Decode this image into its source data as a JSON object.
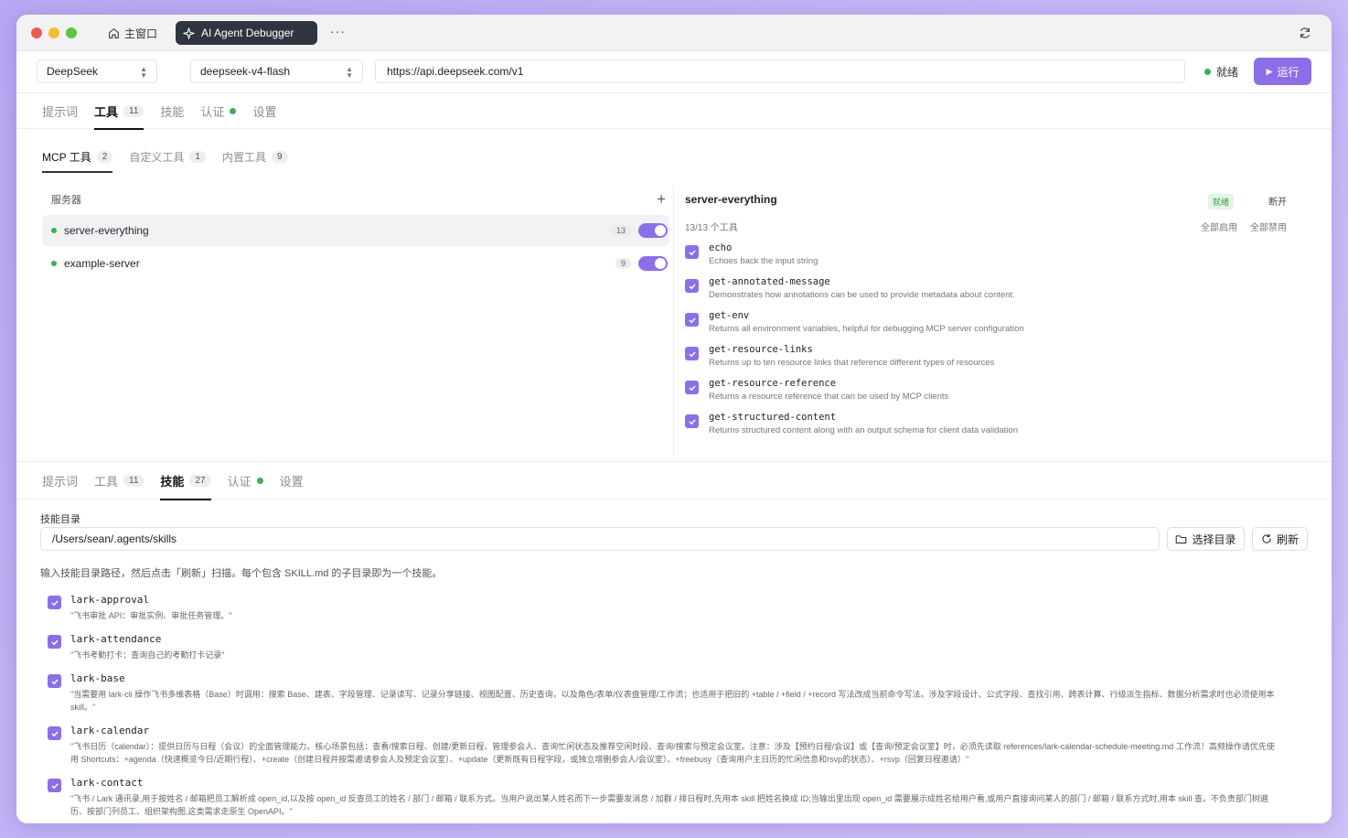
{
  "titlebar": {
    "home_tab": "主窗口",
    "active_tab": "AI Agent Debugger",
    "more": "···"
  },
  "toolbar": {
    "provider": "DeepSeek",
    "model": "deepseek-v4-flash",
    "url": "https://api.deepseek.com/v1",
    "status": "就绪",
    "run_label": "运行"
  },
  "upper": {
    "tabs": [
      {
        "label": "提示词"
      },
      {
        "label": "工具",
        "badge": "11"
      },
      {
        "label": "技能"
      },
      {
        "label": "认证"
      },
      {
        "label": "设置"
      }
    ],
    "subtabs": [
      {
        "label": "MCP 工具",
        "badge": "2"
      },
      {
        "label": "自定义工具",
        "badge": "1"
      },
      {
        "label": "内置工具",
        "badge": "9"
      }
    ],
    "servers_label": "服务器",
    "add": "+",
    "servers": [
      {
        "name": "server-everything",
        "count": "13"
      },
      {
        "name": "example-server",
        "count": "9"
      }
    ],
    "detail": {
      "title": "server-everything",
      "ready": "就绪",
      "disconnect": "断开",
      "summary": "13/13 个工具",
      "enable_all": "全部启用",
      "disable_all": "全部禁用",
      "tools": [
        {
          "name": "echo",
          "desc": "Echoes back the input string"
        },
        {
          "name": "get-annotated-message",
          "desc": "Demonstrates how annotations can be used to provide metadata about content."
        },
        {
          "name": "get-env",
          "desc": "Returns all environment variables, helpful for debugging MCP server configuration"
        },
        {
          "name": "get-resource-links",
          "desc": "Returns up to ten resource links that reference different types of resources"
        },
        {
          "name": "get-resource-reference",
          "desc": "Returns a resource reference that can be used by MCP clients"
        },
        {
          "name": "get-structured-content",
          "desc": "Returns structured content along with an output schema for client data validation"
        }
      ]
    }
  },
  "lower": {
    "tabs": [
      {
        "label": "提示词"
      },
      {
        "label": "工具",
        "badge": "11"
      },
      {
        "label": "技能",
        "badge": "27"
      },
      {
        "label": "认证"
      },
      {
        "label": "设置"
      }
    ],
    "dir_label": "技能目录",
    "dir_value": "/Users/sean/.agents/skills",
    "choose_label": "选择目录",
    "refresh_label": "刷新",
    "hint": "输入技能目录路径，然后点击「刷新」扫描。每个包含 SKILL.md 的子目录即为一个技能。",
    "skills": [
      {
        "name": "lark-approval",
        "desc": "\"飞书审批 API：审批实例、审批任务管理。\""
      },
      {
        "name": "lark-attendance",
        "desc": "\"飞书考勤打卡：查询自己的考勤打卡记录\""
      },
      {
        "name": "lark-base",
        "desc": "\"当需要用 lark-cli 操作飞书多维表格（Base）时调用：搜索 Base、建表、字段管理、记录读写、记录分享链接、视图配置、历史查询，以及角色/表单/仪表盘管理/工作流；也适用于把旧的 +table / +field / +record 写法改成当前命令写法。涉及字段设计、公式字段、查找引用、跨表计算、行级派生指标、数据分析需求时也必须使用本 skill。\""
      },
      {
        "name": "lark-calendar",
        "desc": "\"飞书日历（calendar）：提供日历与日程（会议）的全面管理能力。核心场景包括：查看/搜索日程、创建/更新日程、管理参会人、查询忙闲状态及推荐空闲时段、查询/搜索与预定会议室。注意：涉及【预约日程/会议】或【查询/预定会议室】时，必须先读取 references/lark-calendar-schedule-meeting.md 工作流！高频操作请优先使用 Shortcuts：+agenda（快速概览今日/近期行程）、+create（创建日程并按需邀请参会人及预定会议室）、+update（更新既有日程字段，或独立增删参会人/会议室）、+freebusy（查询用户主日历的忙闲信息和rsvp的状态）、+rsvp（回复日程邀请）\""
      },
      {
        "name": "lark-contact",
        "desc": "\"飞书 / Lark 通讯录,用于按姓名 / 邮箱把员工解析成 open_id,以及按 open_id 反查员工的姓名 / 部门 / 邮箱 / 联系方式。当用户说出某人姓名而下一步需要发消息 / 加群 / 排日程时,先用本 skill 把姓名换成 ID;当输出里出现 open_id 需要展示成姓名给用户看,或用户直接询问某人的部门 / 邮箱 / 联系方式时,用本 skill 查。不负责部门树遍历、按部门列员工、组织架构图,这类需求走原生 OpenAPI。\""
      }
    ]
  }
}
